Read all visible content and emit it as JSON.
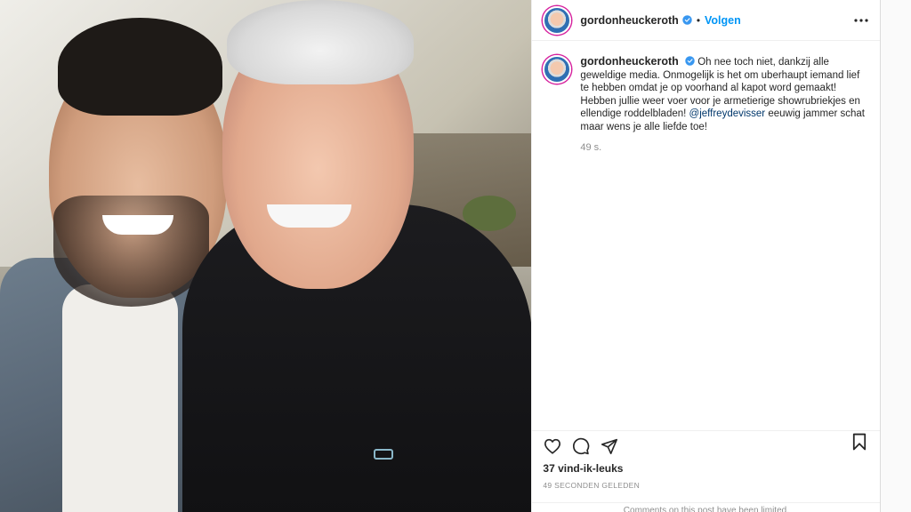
{
  "account": {
    "username": "gordonheuckeroth",
    "follow_label": "Volgen",
    "separator": "•"
  },
  "caption": {
    "username": "gordonheuckeroth",
    "text_before_mention": "Oh nee toch niet, dankzij alle geweldige media. Onmogelijk is het om uberhaupt iemand lief te hebben omdat je op voorhand al kapot word gemaakt! Hebben jullie weer voer voor je armetierige showrubriekjes en ellendige roddelbladen!",
    "mention": "@jeffreydevisser",
    "text_after_mention": "eeuwig jammer schat maar wens je alle liefde toe!",
    "time": "49 s."
  },
  "footer": {
    "likes": "37 vind-ik-leuks",
    "posted": "49 SECONDEN GELEDEN",
    "comments_limited": "Comments on this post have been limited."
  },
  "icons": {
    "verified": "verified-badge-icon",
    "more": "more-options-icon",
    "like": "heart-icon",
    "comment": "comment-icon",
    "share": "share-icon",
    "save": "bookmark-icon"
  },
  "colors": {
    "accent": "#0095f6",
    "verified": "#3897f0",
    "text": "#262626",
    "muted": "#8e8e8e",
    "mention": "#00376b"
  }
}
